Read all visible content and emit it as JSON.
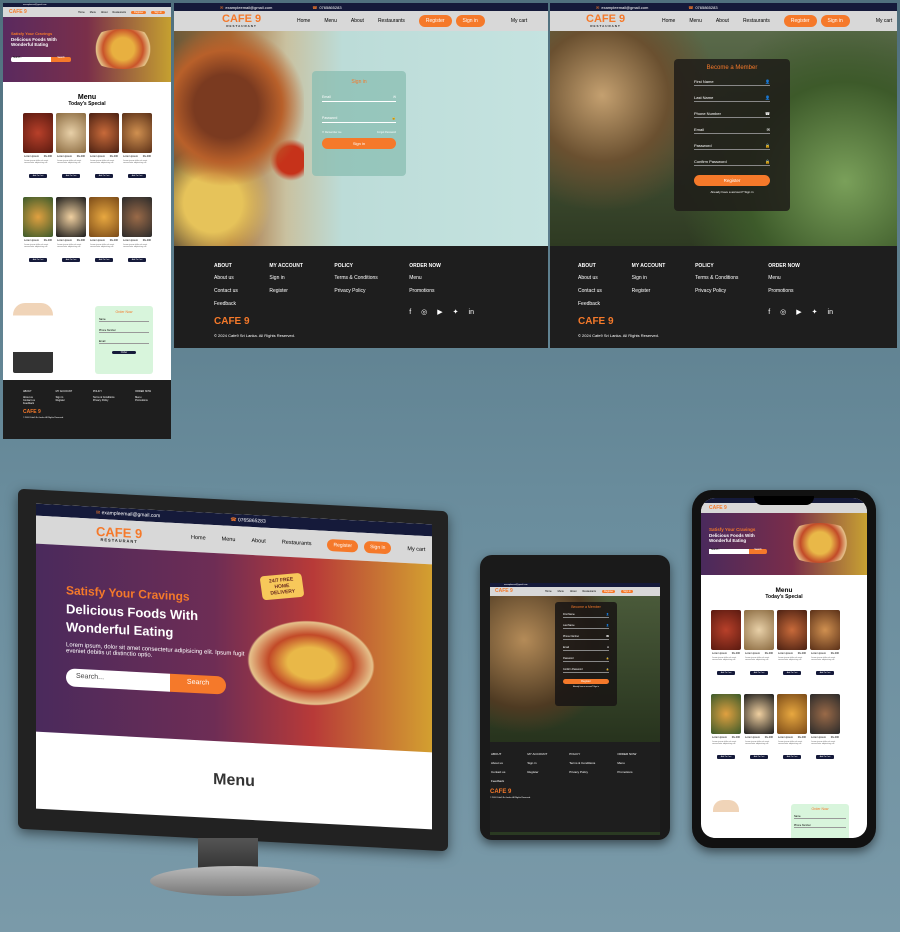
{
  "site": {
    "logo": "CAFE 9",
    "logo_sub": "RESTAURANT",
    "email": "exampleemail@gmail.com",
    "phone": "0765865283",
    "nav": [
      "Home",
      "Menu",
      "About",
      "Restaurants"
    ],
    "register": "Register",
    "signin": "Sign in",
    "cart": "My cart",
    "hero_small": "Satisfy Your Cravings",
    "hero_line1": "Delicious Foods With",
    "hero_line2": "Wonderful Eating",
    "hero_desc": "Lorem ipsum, dolor sit amet consectetur adipisicing elit. Ipsum fugit eveniet debitis ut distinctio optio.",
    "search_placeholder": "Search...",
    "search_btn": "Search",
    "delivery_badge": "24/7 FREE HOME DELIVERY",
    "menu_title": "Menu",
    "menu_sub": "Today's Special",
    "card_title": "Lorem ipsum",
    "card_price": "Rs.400",
    "card_desc": "Lorem ipsum dolor sit amet consectetur adipisicing elit",
    "card_btn": "Add To Cart",
    "order_now": "Order Now"
  },
  "signin_form": {
    "title": "Sign in",
    "email": "Email",
    "password": "Password",
    "remember": "Remember me",
    "forgot": "Forgot Password",
    "button": "Sign in"
  },
  "register_form": {
    "title": "Become a Member",
    "fields": [
      "First Name",
      "Last Name",
      "Phone Number",
      "Email",
      "Password",
      "Confirm Password"
    ],
    "button": "Register",
    "login_prompt": "Already have a account? Sign in"
  },
  "order_form": {
    "title": "Order Now",
    "fields": [
      "Name",
      "Phone Number",
      "Email"
    ],
    "button": "Order"
  },
  "footer": {
    "cols": [
      {
        "title": "ABOUT",
        "items": [
          "About us",
          "Contact us",
          "Feedback"
        ]
      },
      {
        "title": "MY ACCOUNT",
        "items": [
          "Sign in",
          "Register"
        ]
      },
      {
        "title": "POLICY",
        "items": [
          "Terms & Conditions",
          "Privacy Policy"
        ]
      },
      {
        "title": "ORDER NOW",
        "items": [
          "Menu",
          "Promotions"
        ]
      }
    ],
    "copyright": "© 2024 Cafe9 Sri Lanka. All Rights Reserved."
  },
  "monitor_menu_heading": "Menu",
  "colors": {
    "accent": "#f5792a",
    "navy": "#151a3a",
    "footer": "#1e1e1e"
  }
}
